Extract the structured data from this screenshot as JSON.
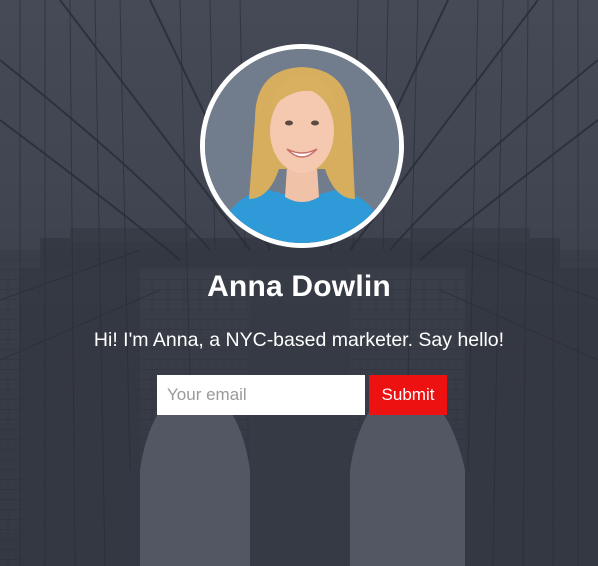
{
  "profile": {
    "name": "Anna Dowlin",
    "tagline": "Hi! I'm Anna, a NYC-based marketer. Say hello!"
  },
  "signup": {
    "email_placeholder": "Your email",
    "submit_label": "Submit"
  },
  "colors": {
    "submit_background": "#ee1111",
    "text": "#ffffff",
    "avatar_ring": "#ffffff"
  }
}
